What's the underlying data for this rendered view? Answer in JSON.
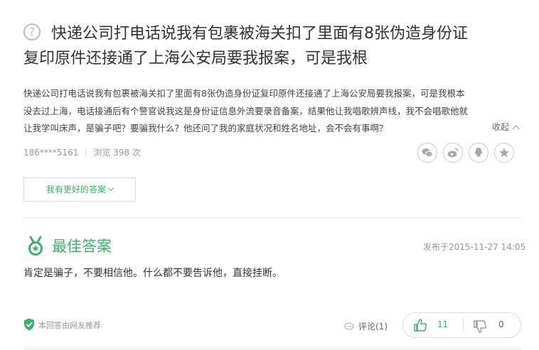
{
  "question": {
    "icon": "question-icon",
    "title_line1": "快递公司打电话说我有包裹被海关扣了里面有8张伪造身份证",
    "title_line2": "复印原件还接通了上海公安局要我报案，可是我根",
    "description_lines": [
      "快递公司打电话说我有包裹被海关扣了里面有8张伪造身份证复印原件还接通了上海公安局要我报案，可是我根本",
      "没去过上海，电话接通后有个警官说我这是身份证信息外流要录音备案，结果他让我唱歌辨声线，我不会唱歌他就",
      "让我学叫床声，是骗子吧？要骗我什么？他还问了我的家庭状况和姓名地址，会不会有事啊？"
    ],
    "collapse_label": "收起",
    "asker": "186****5161",
    "views": "浏览 398 次",
    "share_icons": [
      "wechat-icon",
      "weibo-icon",
      "qq-icon",
      "favorite-icon"
    ]
  },
  "better_answer_button": "我有更好的答案",
  "best_answer": {
    "title": "最佳答案",
    "published": "发布于2015-11-27 14:05",
    "content": "肯定是骗子，不要相信他。什么都不要告诉他，直接挂断。",
    "recommend_label": "本回答由网友推荐",
    "comment_label": "评论(1)",
    "upvotes": "11",
    "downvotes": "0"
  },
  "colors": {
    "accent_green": "#3eb06a",
    "muted_gray": "#999999"
  }
}
